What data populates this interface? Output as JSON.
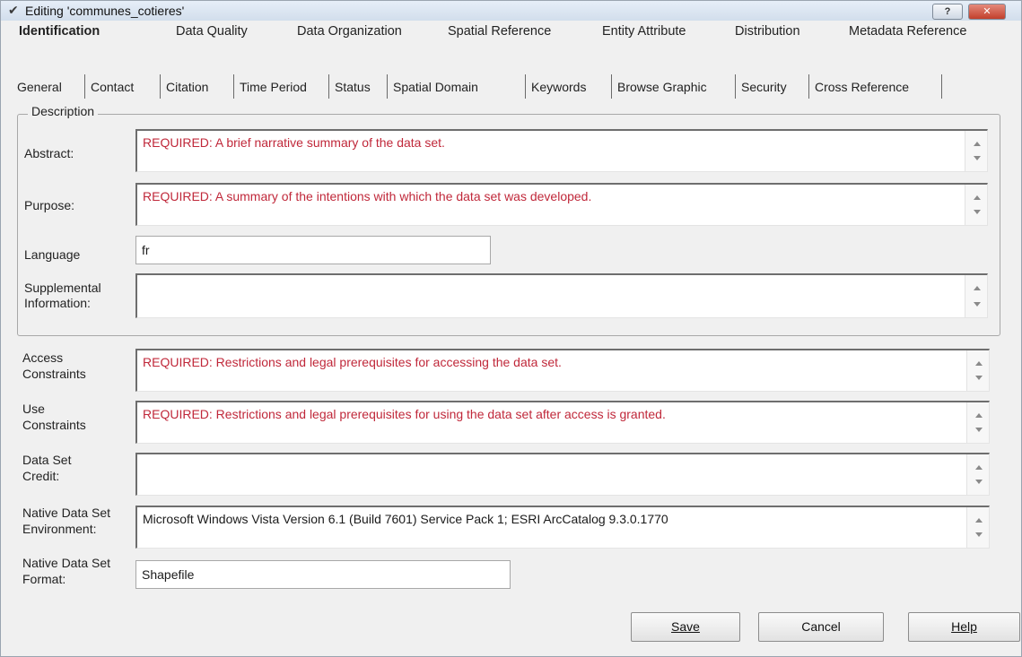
{
  "window": {
    "title": "Editing 'communes_cotieres'",
    "help_label": "?",
    "close_label": "✕"
  },
  "section_tabs": [
    {
      "label": "Identification",
      "active": true
    },
    {
      "label": "Data Quality"
    },
    {
      "label": "Data Organization"
    },
    {
      "label": "Spatial Reference"
    },
    {
      "label": "Entity Attribute"
    },
    {
      "label": "Distribution"
    },
    {
      "label": "Metadata Reference"
    }
  ],
  "sub_tabs": [
    {
      "label": "General"
    },
    {
      "label": "Contact"
    },
    {
      "label": "Citation"
    },
    {
      "label": "Time Period"
    },
    {
      "label": "Status"
    },
    {
      "label": "Spatial Domain"
    },
    {
      "label": "Keywords"
    },
    {
      "label": "Browse Graphic"
    },
    {
      "label": "Security"
    },
    {
      "label": "Cross Reference"
    }
  ],
  "description": {
    "legend": "Description",
    "abstract_label": "Abstract:",
    "abstract_value": "REQUIRED: A brief narrative summary of the data set.",
    "purpose_label": "Purpose:",
    "purpose_value": "REQUIRED: A summary of the intentions with which the data set was developed.",
    "language_label": "Language",
    "language_value": "fr",
    "supplemental_label_1": "Supplemental",
    "supplemental_label_2": "Information:",
    "supplemental_value": ""
  },
  "fields": {
    "access_label_1": "Access",
    "access_label_2": "Constraints",
    "access_value": "REQUIRED: Restrictions and legal prerequisites for accessing the data set.",
    "use_label_1": "Use",
    "use_label_2": "Constraints",
    "use_value": "REQUIRED: Restrictions and legal prerequisites for using the data set after access is granted.",
    "credit_label_1": "Data Set",
    "credit_label_2": "Credit:",
    "credit_value": "",
    "env_label_1": "Native Data Set",
    "env_label_2": "Environment:",
    "env_value": "Microsoft Windows Vista Version 6.1 (Build 7601) Service Pack 1; ESRI ArcCatalog 9.3.0.1770",
    "format_label_1": "Native Data Set",
    "format_label_2": "Format:",
    "format_value": "Shapefile"
  },
  "buttons": {
    "save": "Save",
    "cancel": "Cancel",
    "help": "Help"
  }
}
